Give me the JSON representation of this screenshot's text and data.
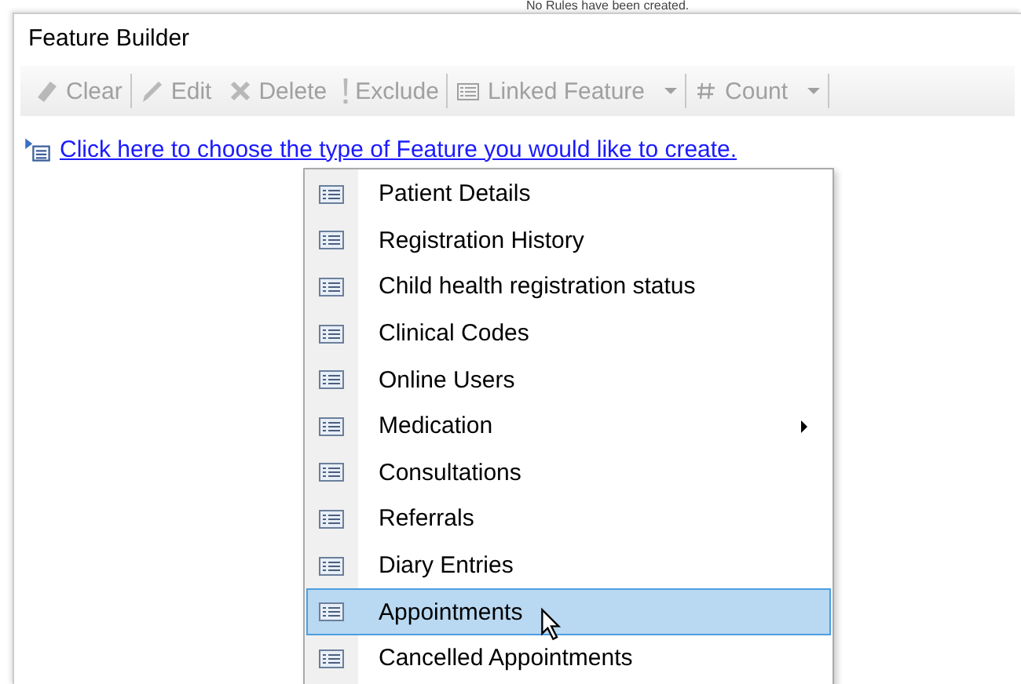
{
  "background_text": "No Rules have been created.",
  "window": {
    "title": "Feature Builder"
  },
  "toolbar_groups": [
    [
      {
        "kind": "eraser",
        "label": "Clear",
        "disabled": true,
        "dropdown": false
      }
    ],
    [
      {
        "kind": "pencil",
        "label": "Edit",
        "disabled": true,
        "dropdown": false
      },
      {
        "kind": "delete",
        "label": "Delete",
        "disabled": true,
        "dropdown": false
      },
      {
        "kind": "exclamation",
        "label": "Exclude",
        "disabled": true,
        "dropdown": false
      }
    ],
    [
      {
        "kind": "list",
        "label": "Linked Feature",
        "disabled": true,
        "dropdown": true
      }
    ],
    [
      {
        "kind": "hash",
        "label": "Count",
        "disabled": true,
        "dropdown": true
      }
    ]
  ],
  "link": {
    "text": "Click here to choose the type of Feature you would like to create."
  },
  "menu": {
    "items": [
      {
        "label": "Patient Details",
        "selected": false,
        "submenu": false
      },
      {
        "label": "Registration History",
        "selected": false,
        "submenu": false
      },
      {
        "label": "Child health registration status",
        "selected": false,
        "submenu": false
      },
      {
        "label": "Clinical Codes",
        "selected": false,
        "submenu": false
      },
      {
        "label": "Online Users",
        "selected": false,
        "submenu": false
      },
      {
        "label": "Medication",
        "selected": false,
        "submenu": true
      },
      {
        "label": "Consultations",
        "selected": false,
        "submenu": false
      },
      {
        "label": "Referrals",
        "selected": false,
        "submenu": false
      },
      {
        "label": "Diary Entries",
        "selected": false,
        "submenu": false
      },
      {
        "label": "Appointments",
        "selected": true,
        "submenu": false
      },
      {
        "label": "Cancelled Appointments",
        "selected": false,
        "submenu": false
      }
    ]
  }
}
